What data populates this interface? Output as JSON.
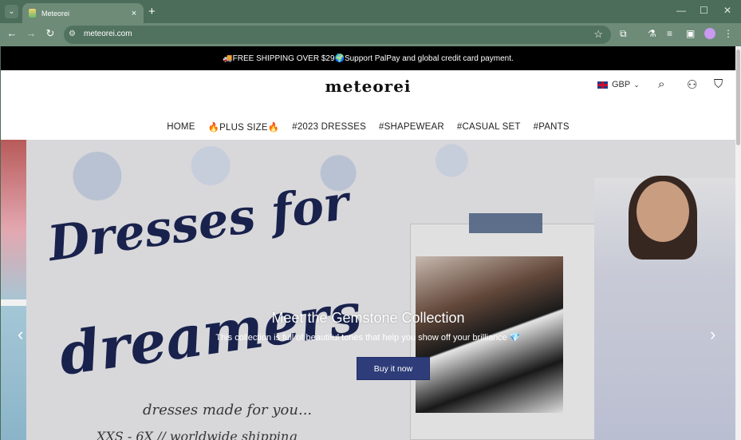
{
  "browser": {
    "tab_title": "Meteorei",
    "url": "meteorei.com",
    "new_tab": "+",
    "close_tab": "×"
  },
  "announcement": "🚚FREE SHIPPING OVER $29🌍Support PalPay and global credit card payment.",
  "header": {
    "logo": "meteorei",
    "currency": "GBP"
  },
  "nav": {
    "items": [
      "HOME",
      "🔥PLUS SIZE🔥",
      "#2023 DRESSES",
      "#SHAPEWEAR",
      "#CASUAL SET",
      "#PANTS"
    ]
  },
  "hero": {
    "art_line1": "Dresses for",
    "art_line2": "dreamers",
    "art_line3": "dresses made for you...",
    "art_line4": "XXS - 6X // worldwide shipping",
    "title": "Meet the Gemstone Collection",
    "subtitle": "This collection is full of beautiful tones that help you show off your brilliance 💎",
    "button": "Buy it now"
  },
  "icons": {
    "prev": "‹",
    "next": "›"
  }
}
